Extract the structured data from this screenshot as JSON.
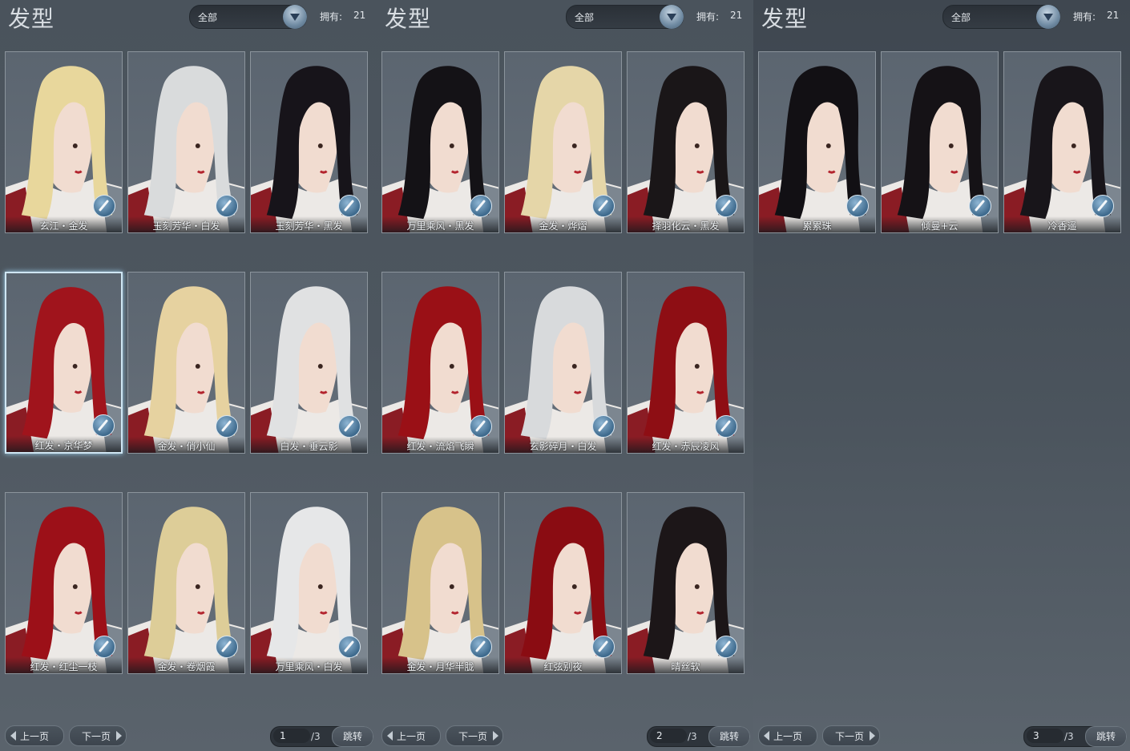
{
  "panels": [
    {
      "title": "发型",
      "filter": {
        "value": "全部"
      },
      "owned": {
        "label": "拥有:",
        "count": "21"
      },
      "items": [
        "玄江・金发",
        "玉刻芳华・白发",
        "玉刻芳华・黑发",
        "红发・京华梦",
        "金发・俏小仙",
        "白发・垂云影",
        "红发・红尘一枝",
        "金发・卷烟霞",
        "万里乘风・白发"
      ],
      "hair_colors": [
        "#e8d79c",
        "#d9dbdc",
        "#17141a",
        "#a0141c",
        "#e6d2a0",
        "#e0e1e2",
        "#9c1018",
        "#ddcd98",
        "#e6e7e8"
      ],
      "selected_index": 3,
      "nav": {
        "prev": "上一页",
        "next": "下一页"
      },
      "pager": {
        "page": "1",
        "total": "/3",
        "jump": "跳转"
      }
    },
    {
      "title": "发型",
      "filter": {
        "value": "全部"
      },
      "owned": {
        "label": "拥有:",
        "count": "21"
      },
      "items": [
        "万里乘风・黑发",
        "金发・烨熠",
        "择羽化云・黑发",
        "红发・流焰飞瞬",
        "玄影碎月・白发",
        "红发・赤辰凌风",
        "金发・月华半胧",
        "红弦别夜",
        "晴丝软"
      ],
      "hair_colors": [
        "#141216",
        "#e5d6a8",
        "#1a1618",
        "#9a1016",
        "#d8dadc",
        "#8e0e14",
        "#d7c28a",
        "#8a0c12",
        "#1c1618"
      ],
      "selected_index": -1,
      "nav": {
        "prev": "上一页",
        "next": "下一页"
      },
      "pager": {
        "page": "2",
        "total": "/3",
        "jump": "跳转"
      }
    },
    {
      "title": "发型",
      "filter": {
        "value": "全部"
      },
      "owned": {
        "label": "拥有:",
        "count": "21"
      },
      "items": [
        "累累珠",
        "倾曼+云",
        "冷香遥"
      ],
      "hair_colors": [
        "#121014",
        "#151216",
        "#18151a"
      ],
      "selected_index": -1,
      "nav": {
        "prev": "上一页",
        "next": "下一页"
      },
      "pager": {
        "page": "3",
        "total": "/3",
        "jump": "跳转"
      }
    }
  ]
}
